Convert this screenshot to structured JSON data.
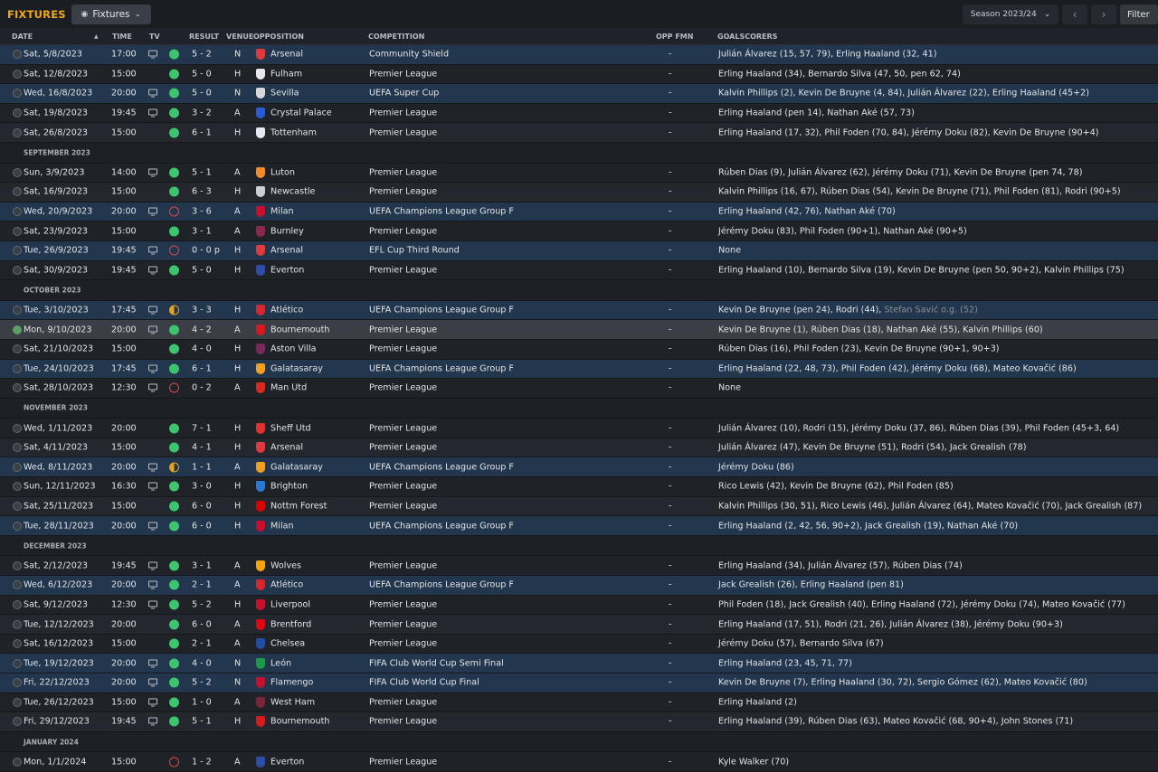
{
  "topbar": {
    "title": "FIXTURES",
    "view_label": "Fixtures",
    "season_label": "Season 2023/24",
    "filter_label": "Filter"
  },
  "columns": {
    "date": "DATE",
    "time": "TIME",
    "tv": "TV",
    "result": "RESULT",
    "venue": "VENUE",
    "opposition": "OPPOSITION",
    "competition": "COMPETITION",
    "opp_fmn": "OPP FMN",
    "goalscorers": "GOALSCORERS"
  },
  "badge_colors": {
    "Arsenal": "#e03a3e",
    "Fulham": "#e8e8e8",
    "Sevilla": "#d8d8d8",
    "Crystal Palace": "#2a5bd7",
    "Tottenham": "#e8e8f0",
    "Luton": "#f28c28",
    "Newcastle": "#cfcfcf",
    "Milan": "#c8102e",
    "Burnley": "#8a2a4a",
    "Everton": "#2d4ea8",
    "Atlético": "#d6272f",
    "Bournemouth": "#d71920",
    "Aston Villa": "#7a2a5a",
    "Galatasaray": "#f0a020",
    "Man Utd": "#da291c",
    "Sheff Utd": "#e03030",
    "Brighton": "#2a7ad5",
    "Nottm Forest": "#dd0000",
    "Wolves": "#f5a30b",
    "Liverpool": "#c8102e",
    "Brentford": "#e30613",
    "Chelsea": "#1f4ea3",
    "León": "#1b9a45",
    "Flamengo": "#c8102e",
    "West Ham": "#7a263a"
  },
  "items": [
    {
      "kind": "match",
      "date": "Sat, 5/8/2023",
      "time": "17:00",
      "tv": true,
      "result": "W",
      "score": "5 - 2",
      "venue": "N",
      "opp": "Arsenal",
      "comp": "Community Shield",
      "fmn": "-",
      "goals": "Julián Álvarez (15, 57, 79), Erling Haaland (32, 41)",
      "status": "done",
      "band": "cup"
    },
    {
      "kind": "match",
      "date": "Sat, 12/8/2023",
      "time": "15:00",
      "tv": false,
      "result": "W",
      "score": "5 - 0",
      "venue": "H",
      "opp": "Fulham",
      "comp": "Premier League",
      "fmn": "-",
      "goals": "Erling Haaland (34), Bernardo Silva (47, 50, pen 62, 74)",
      "status": "done",
      "band": "even"
    },
    {
      "kind": "match",
      "date": "Wed, 16/8/2023",
      "time": "20:00",
      "tv": true,
      "result": "W",
      "score": "5 - 0",
      "venue": "N",
      "opp": "Sevilla",
      "comp": "UEFA Super Cup",
      "fmn": "-",
      "goals": "Kalvin Phillips (2), Kevin De Bruyne (4, 84), Julián Álvarez (22), Erling Haaland (45+2)",
      "status": "done",
      "band": "cup"
    },
    {
      "kind": "match",
      "date": "Sat, 19/8/2023",
      "time": "19:45",
      "tv": true,
      "result": "W",
      "score": "3 - 2",
      "venue": "A",
      "opp": "Crystal Palace",
      "comp": "Premier League",
      "fmn": "-",
      "goals": "Erling Haaland (pen 14), Nathan Aké (57, 73)",
      "status": "done",
      "band": "even"
    },
    {
      "kind": "match",
      "date": "Sat, 26/8/2023",
      "time": "15:00",
      "tv": false,
      "result": "W",
      "score": "6 - 1",
      "venue": "H",
      "opp": "Tottenham",
      "comp": "Premier League",
      "fmn": "-",
      "goals": "Erling Haaland (17, 32), Phil Foden (70, 84), Jérémy Doku (82), Kevin De Bruyne (90+4)",
      "status": "done",
      "band": "odd"
    },
    {
      "kind": "month",
      "label": "SEPTEMBER 2023"
    },
    {
      "kind": "match",
      "date": "Sun, 3/9/2023",
      "time": "14:00",
      "tv": true,
      "result": "W",
      "score": "5 - 1",
      "venue": "A",
      "opp": "Luton",
      "comp": "Premier League",
      "fmn": "-",
      "goals": "Rúben Dias (9), Julián Álvarez (62), Jérémy Doku (71), Kevin De Bruyne (pen 74, 78)",
      "status": "done",
      "band": "even"
    },
    {
      "kind": "match",
      "date": "Sat, 16/9/2023",
      "time": "15:00",
      "tv": false,
      "result": "W",
      "score": "6 - 3",
      "venue": "H",
      "opp": "Newcastle",
      "comp": "Premier League",
      "fmn": "-",
      "goals": "Kalvin Phillips (16, 67), Rúben Dias (54), Kevin De Bruyne (71), Phil Foden (81), Rodri (90+5)",
      "status": "done",
      "band": "odd"
    },
    {
      "kind": "match",
      "date": "Wed, 20/9/2023",
      "time": "20:00",
      "tv": true,
      "result": "L",
      "score": "3 - 6",
      "venue": "A",
      "opp": "Milan",
      "comp": "UEFA Champions League Group F",
      "fmn": "-",
      "goals": "Erling Haaland (42, 76), Nathan Aké (70)",
      "status": "done",
      "band": "cup"
    },
    {
      "kind": "match",
      "date": "Sat, 23/9/2023",
      "time": "15:00",
      "tv": false,
      "result": "W",
      "score": "3 - 1",
      "venue": "A",
      "opp": "Burnley",
      "comp": "Premier League",
      "fmn": "-",
      "goals": "Jérémy Doku (83), Phil Foden (90+1), Nathan Aké (90+5)",
      "status": "done",
      "band": "even"
    },
    {
      "kind": "match",
      "date": "Tue, 26/9/2023",
      "time": "19:45",
      "tv": true,
      "result": "L",
      "score": "0 - 0 p",
      "venue": "H",
      "opp": "Arsenal",
      "comp": "EFL Cup Third Round",
      "fmn": "-",
      "goals": "None",
      "status": "done",
      "band": "cup"
    },
    {
      "kind": "match",
      "date": "Sat, 30/9/2023",
      "time": "19:45",
      "tv": true,
      "result": "W",
      "score": "5 - 0",
      "venue": "H",
      "opp": "Everton",
      "comp": "Premier League",
      "fmn": "-",
      "goals": "Erling Haaland (10), Bernardo Silva (19), Kevin De Bruyne (pen 50, 90+2), Kalvin Phillips (75)",
      "status": "done",
      "band": "even"
    },
    {
      "kind": "month",
      "label": "OCTOBER 2023"
    },
    {
      "kind": "match",
      "date": "Tue, 3/10/2023",
      "time": "17:45",
      "tv": true,
      "result": "D",
      "score": "3 - 3",
      "venue": "H",
      "opp": "Atlético",
      "comp": "UEFA Champions League Group F",
      "fmn": "-",
      "goals": "Kevin De Bruyne (pen 24), Rodri (44), ",
      "og": "Stefan Savić o.g. (52)",
      "status": "done",
      "band": "cup"
    },
    {
      "kind": "match",
      "date": "Mon, 9/10/2023",
      "time": "20:00",
      "tv": true,
      "result": "W",
      "score": "4 - 2",
      "venue": "A",
      "opp": "Bournemouth",
      "comp": "Premier League",
      "fmn": "-",
      "goals": "Kevin De Bruyne (1), Rúben Dias (18), Nathan Aké (55), Kalvin Phillips (60)",
      "status": "now",
      "band": "current"
    },
    {
      "kind": "match",
      "date": "Sat, 21/10/2023",
      "time": "15:00",
      "tv": false,
      "result": "W",
      "score": "4 - 0",
      "venue": "H",
      "opp": "Aston Villa",
      "comp": "Premier League",
      "fmn": "-",
      "goals": "Rúben Dias (16), Phil Foden (23), Kevin De Bruyne (90+1, 90+3)",
      "status": "done",
      "band": "even"
    },
    {
      "kind": "match",
      "date": "Tue, 24/10/2023",
      "time": "17:45",
      "tv": true,
      "result": "W",
      "score": "6 - 1",
      "venue": "H",
      "opp": "Galatasaray",
      "comp": "UEFA Champions League Group F",
      "fmn": "-",
      "goals": "Erling Haaland (22, 48, 73), Phil Foden (42), Jérémy Doku (68), Mateo Kovačić (86)",
      "status": "done",
      "band": "cup"
    },
    {
      "kind": "match",
      "date": "Sat, 28/10/2023",
      "time": "12:30",
      "tv": true,
      "result": "L",
      "score": "0 - 2",
      "venue": "A",
      "opp": "Man Utd",
      "comp": "Premier League",
      "fmn": "-",
      "goals": "None",
      "status": "done",
      "band": "even"
    },
    {
      "kind": "month",
      "label": "NOVEMBER 2023"
    },
    {
      "kind": "match",
      "date": "Wed, 1/11/2023",
      "time": "20:00",
      "tv": false,
      "result": "W",
      "score": "7 - 1",
      "venue": "H",
      "opp": "Sheff Utd",
      "comp": "Premier League",
      "fmn": "-",
      "goals": "Julián Álvarez (10), Rodri (15), Jérémy Doku (37, 86), Rúben Dias (39), Phil Foden (45+3, 64)",
      "status": "done",
      "band": "even"
    },
    {
      "kind": "match",
      "date": "Sat, 4/11/2023",
      "time": "15:00",
      "tv": false,
      "result": "W",
      "score": "4 - 1",
      "venue": "H",
      "opp": "Arsenal",
      "comp": "Premier League",
      "fmn": "-",
      "goals": "Julián Álvarez (47), Kevin De Bruyne (51), Rodri (54), Jack Grealish (78)",
      "status": "done",
      "band": "odd"
    },
    {
      "kind": "match",
      "date": "Wed, 8/11/2023",
      "time": "20:00",
      "tv": true,
      "result": "D",
      "score": "1 - 1",
      "venue": "A",
      "opp": "Galatasaray",
      "comp": "UEFA Champions League Group F",
      "fmn": "-",
      "goals": "Jérémy Doku (86)",
      "status": "done",
      "band": "cup"
    },
    {
      "kind": "match",
      "date": "Sun, 12/11/2023",
      "time": "16:30",
      "tv": true,
      "result": "W",
      "score": "3 - 0",
      "venue": "H",
      "opp": "Brighton",
      "comp": "Premier League",
      "fmn": "-",
      "goals": "Rico Lewis (42), Kevin De Bruyne (62), Phil Foden (85)",
      "status": "done",
      "band": "even"
    },
    {
      "kind": "match",
      "date": "Sat, 25/11/2023",
      "time": "15:00",
      "tv": false,
      "result": "W",
      "score": "6 - 0",
      "venue": "H",
      "opp": "Nottm Forest",
      "comp": "Premier League",
      "fmn": "-",
      "goals": "Kalvin Phillips (30, 51), Rico Lewis (46), Julián Álvarez (64), Mateo Kovačić (70), Jack Grealish (87)",
      "status": "done",
      "band": "odd"
    },
    {
      "kind": "match",
      "date": "Tue, 28/11/2023",
      "time": "20:00",
      "tv": true,
      "result": "W",
      "score": "6 - 0",
      "venue": "H",
      "opp": "Milan",
      "comp": "UEFA Champions League Group F",
      "fmn": "-",
      "goals": "Erling Haaland (2, 42, 56, 90+2), Jack Grealish (19), Nathan Aké (70)",
      "status": "done",
      "band": "cup"
    },
    {
      "kind": "month",
      "label": "DECEMBER 2023"
    },
    {
      "kind": "match",
      "date": "Sat, 2/12/2023",
      "time": "19:45",
      "tv": true,
      "result": "W",
      "score": "3 - 1",
      "venue": "A",
      "opp": "Wolves",
      "comp": "Premier League",
      "fmn": "-",
      "goals": "Erling Haaland (34), Julián Álvarez (57), Rúben Dias (74)",
      "status": "done",
      "band": "even"
    },
    {
      "kind": "match",
      "date": "Wed, 6/12/2023",
      "time": "20:00",
      "tv": true,
      "result": "W",
      "score": "2 - 1",
      "venue": "A",
      "opp": "Atlético",
      "comp": "UEFA Champions League Group F",
      "fmn": "-",
      "goals": "Jack Grealish (26), Erling Haaland (pen 81)",
      "status": "done",
      "band": "cup"
    },
    {
      "kind": "match",
      "date": "Sat, 9/12/2023",
      "time": "12:30",
      "tv": true,
      "result": "W",
      "score": "5 - 2",
      "venue": "H",
      "opp": "Liverpool",
      "comp": "Premier League",
      "fmn": "-",
      "goals": "Phil Foden (18), Jack Grealish (40), Erling Haaland (72), Jérémy Doku (74), Mateo Kovačić (77)",
      "status": "done",
      "band": "even"
    },
    {
      "kind": "match",
      "date": "Tue, 12/12/2023",
      "time": "20:00",
      "tv": false,
      "result": "W",
      "score": "6 - 0",
      "venue": "A",
      "opp": "Brentford",
      "comp": "Premier League",
      "fmn": "-",
      "goals": "Erling Haaland (17, 51), Rodri (21, 26), Julián Álvarez (38), Jérémy Doku (90+3)",
      "status": "done",
      "band": "odd"
    },
    {
      "kind": "match",
      "date": "Sat, 16/12/2023",
      "time": "15:00",
      "tv": false,
      "result": "W",
      "score": "2 - 1",
      "venue": "A",
      "opp": "Chelsea",
      "comp": "Premier League",
      "fmn": "-",
      "goals": "Jérémy Doku (57), Bernardo Silva (67)",
      "status": "done",
      "band": "even"
    },
    {
      "kind": "match",
      "date": "Tue, 19/12/2023",
      "time": "20:00",
      "tv": true,
      "result": "W",
      "score": "4 - 0",
      "venue": "N",
      "opp": "León",
      "comp": "FIFA Club World Cup Semi Final",
      "fmn": "-",
      "goals": "Erling Haaland (23, 45, 71, 77)",
      "status": "done",
      "band": "cup"
    },
    {
      "kind": "match",
      "date": "Fri, 22/12/2023",
      "time": "20:00",
      "tv": true,
      "result": "W",
      "score": "5 - 2",
      "venue": "N",
      "opp": "Flamengo",
      "comp": "FIFA Club World Cup Final",
      "fmn": "-",
      "goals": "Kevin De Bruyne (7), Erling Haaland (30, 72), Sergio Gómez (62), Mateo Kovačić (80)",
      "status": "done",
      "band": "cup"
    },
    {
      "kind": "match",
      "date": "Tue, 26/12/2023",
      "time": "15:00",
      "tv": true,
      "result": "W",
      "score": "1 - 0",
      "venue": "A",
      "opp": "West Ham",
      "comp": "Premier League",
      "fmn": "-",
      "goals": "Erling Haaland (2)",
      "status": "done",
      "band": "even"
    },
    {
      "kind": "match",
      "date": "Fri, 29/12/2023",
      "time": "19:45",
      "tv": true,
      "result": "W",
      "score": "5 - 1",
      "venue": "H",
      "opp": "Bournemouth",
      "comp": "Premier League",
      "fmn": "-",
      "goals": "Erling Haaland (39), Rúben Dias (63), Mateo Kovačić (68, 90+4), John Stones (71)",
      "status": "done",
      "band": "odd"
    },
    {
      "kind": "month",
      "label": "JANUARY 2024"
    },
    {
      "kind": "match",
      "date": "Mon, 1/1/2024",
      "time": "15:00",
      "tv": false,
      "result": "L",
      "score": "1 - 2",
      "venue": "A",
      "opp": "Everton",
      "comp": "Premier League",
      "fmn": "-",
      "goals": "Kyle Walker (70)",
      "status": "done",
      "band": "even"
    }
  ]
}
